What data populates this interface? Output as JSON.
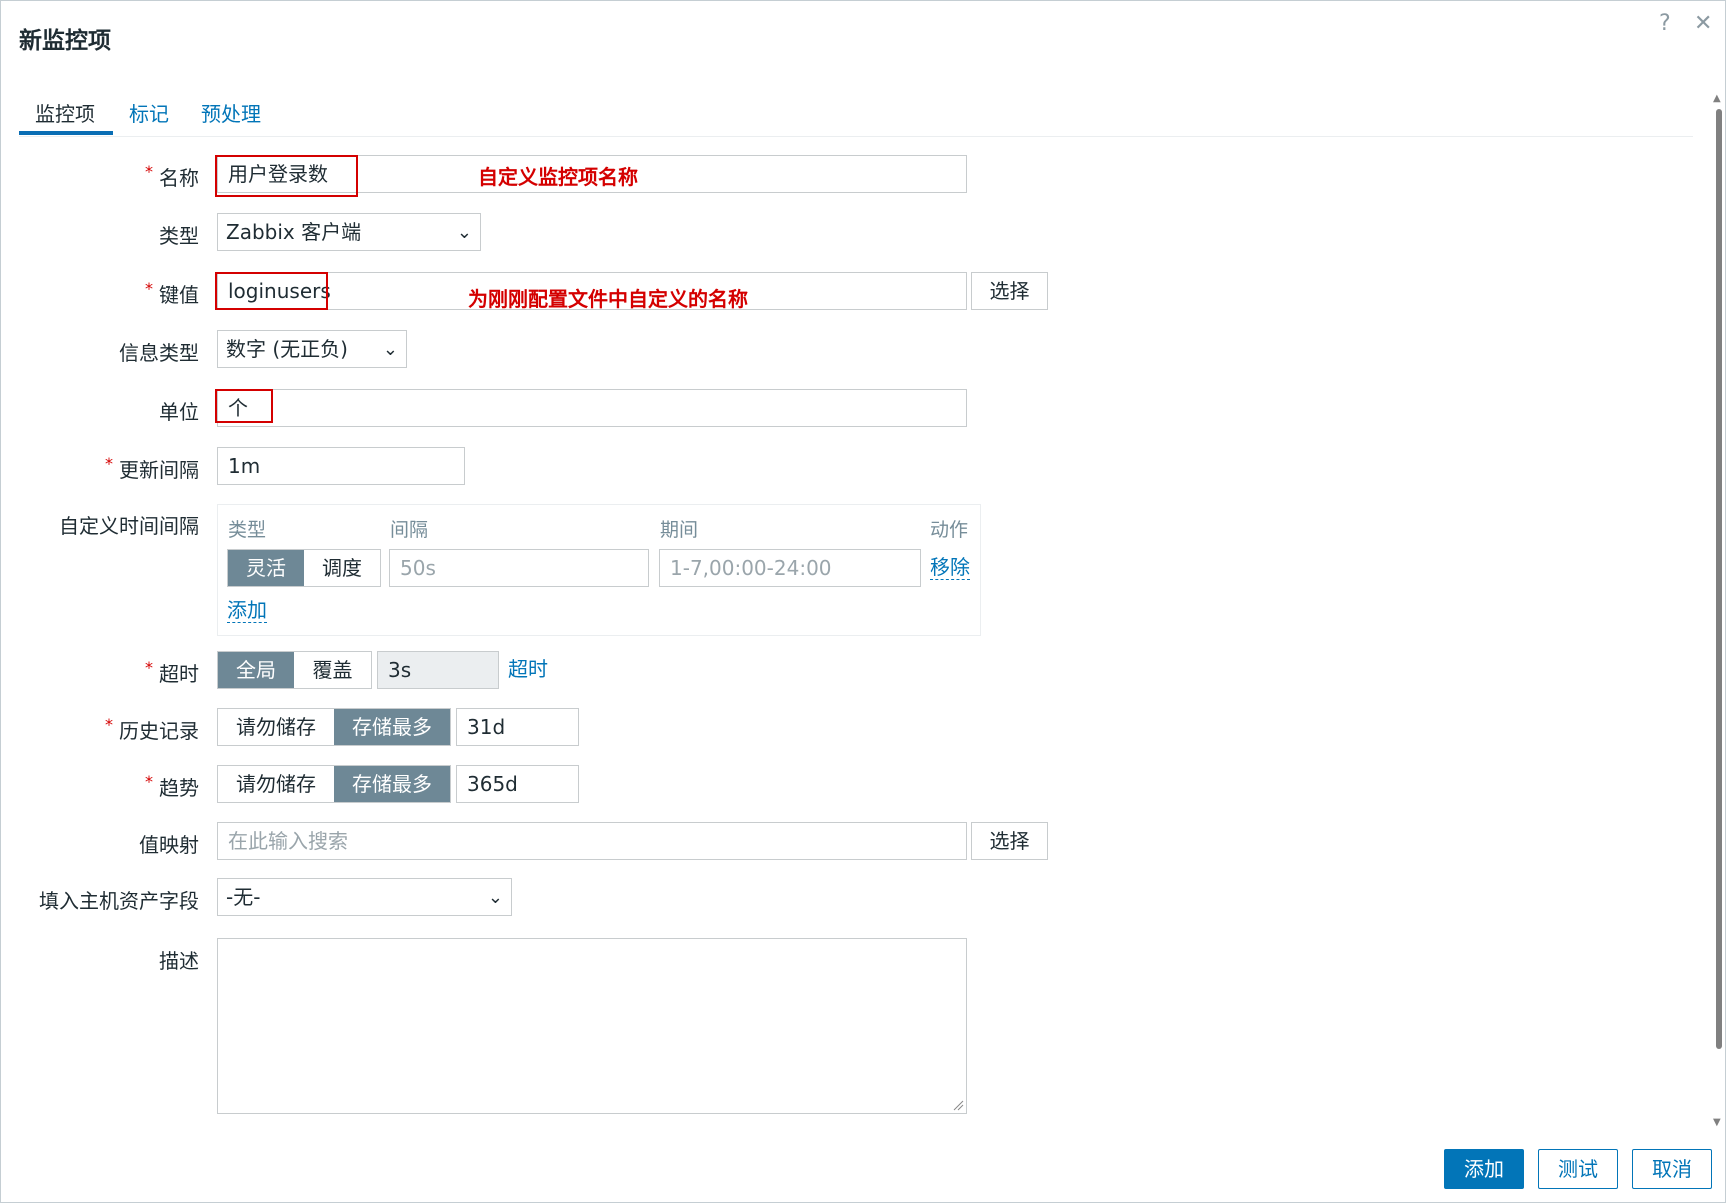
{
  "dialog": {
    "title": "新监控项",
    "help_icon": "?",
    "close_icon": "✕"
  },
  "tabs": [
    {
      "label": "监控项"
    },
    {
      "label": "标记"
    },
    {
      "label": "预处理"
    }
  ],
  "form": {
    "name": {
      "label": "名称",
      "value": "用户登录数",
      "annotation": "自定义监控项名称"
    },
    "type": {
      "label": "类型",
      "value": "Zabbix 客户端"
    },
    "key": {
      "label": "键值",
      "value": "loginusers",
      "annotation": "为刚刚配置文件中自定义的名称",
      "select_label": "选择"
    },
    "info_type": {
      "label": "信息类型",
      "value": "数字 (无正负)"
    },
    "unit": {
      "label": "单位",
      "value": "个"
    },
    "update_interval": {
      "label": "更新间隔",
      "value": "1m"
    },
    "custom_intervals": {
      "label": "自定义时间间隔",
      "headers": [
        "类型",
        "间隔",
        "期间",
        "动作"
      ],
      "type_options": [
        "灵活",
        "调度"
      ],
      "interval_placeholder": "50s",
      "period_placeholder": "1-7,00:00-24:00",
      "remove_label": "移除",
      "add_label": "添加"
    },
    "timeout": {
      "label": "超时",
      "options": [
        "全局",
        "覆盖"
      ],
      "value": "3s",
      "link": "超时"
    },
    "history": {
      "label": "历史记录",
      "options": [
        "请勿储存",
        "存储最多"
      ],
      "value": "31d"
    },
    "trends": {
      "label": "趋势",
      "options": [
        "请勿储存",
        "存储最多"
      ],
      "value": "365d"
    },
    "value_map": {
      "label": "值映射",
      "placeholder": "在此输入搜索",
      "select_label": "选择"
    },
    "inventory": {
      "label": "填入主机资产字段",
      "value": "-无-"
    },
    "description": {
      "label": "描述"
    }
  },
  "footer": {
    "add": "添加",
    "test": "测试",
    "cancel": "取消"
  },
  "colors": {
    "accent": "#0275b8",
    "annotation": "#d40000",
    "segment_on": "#6e8896"
  }
}
